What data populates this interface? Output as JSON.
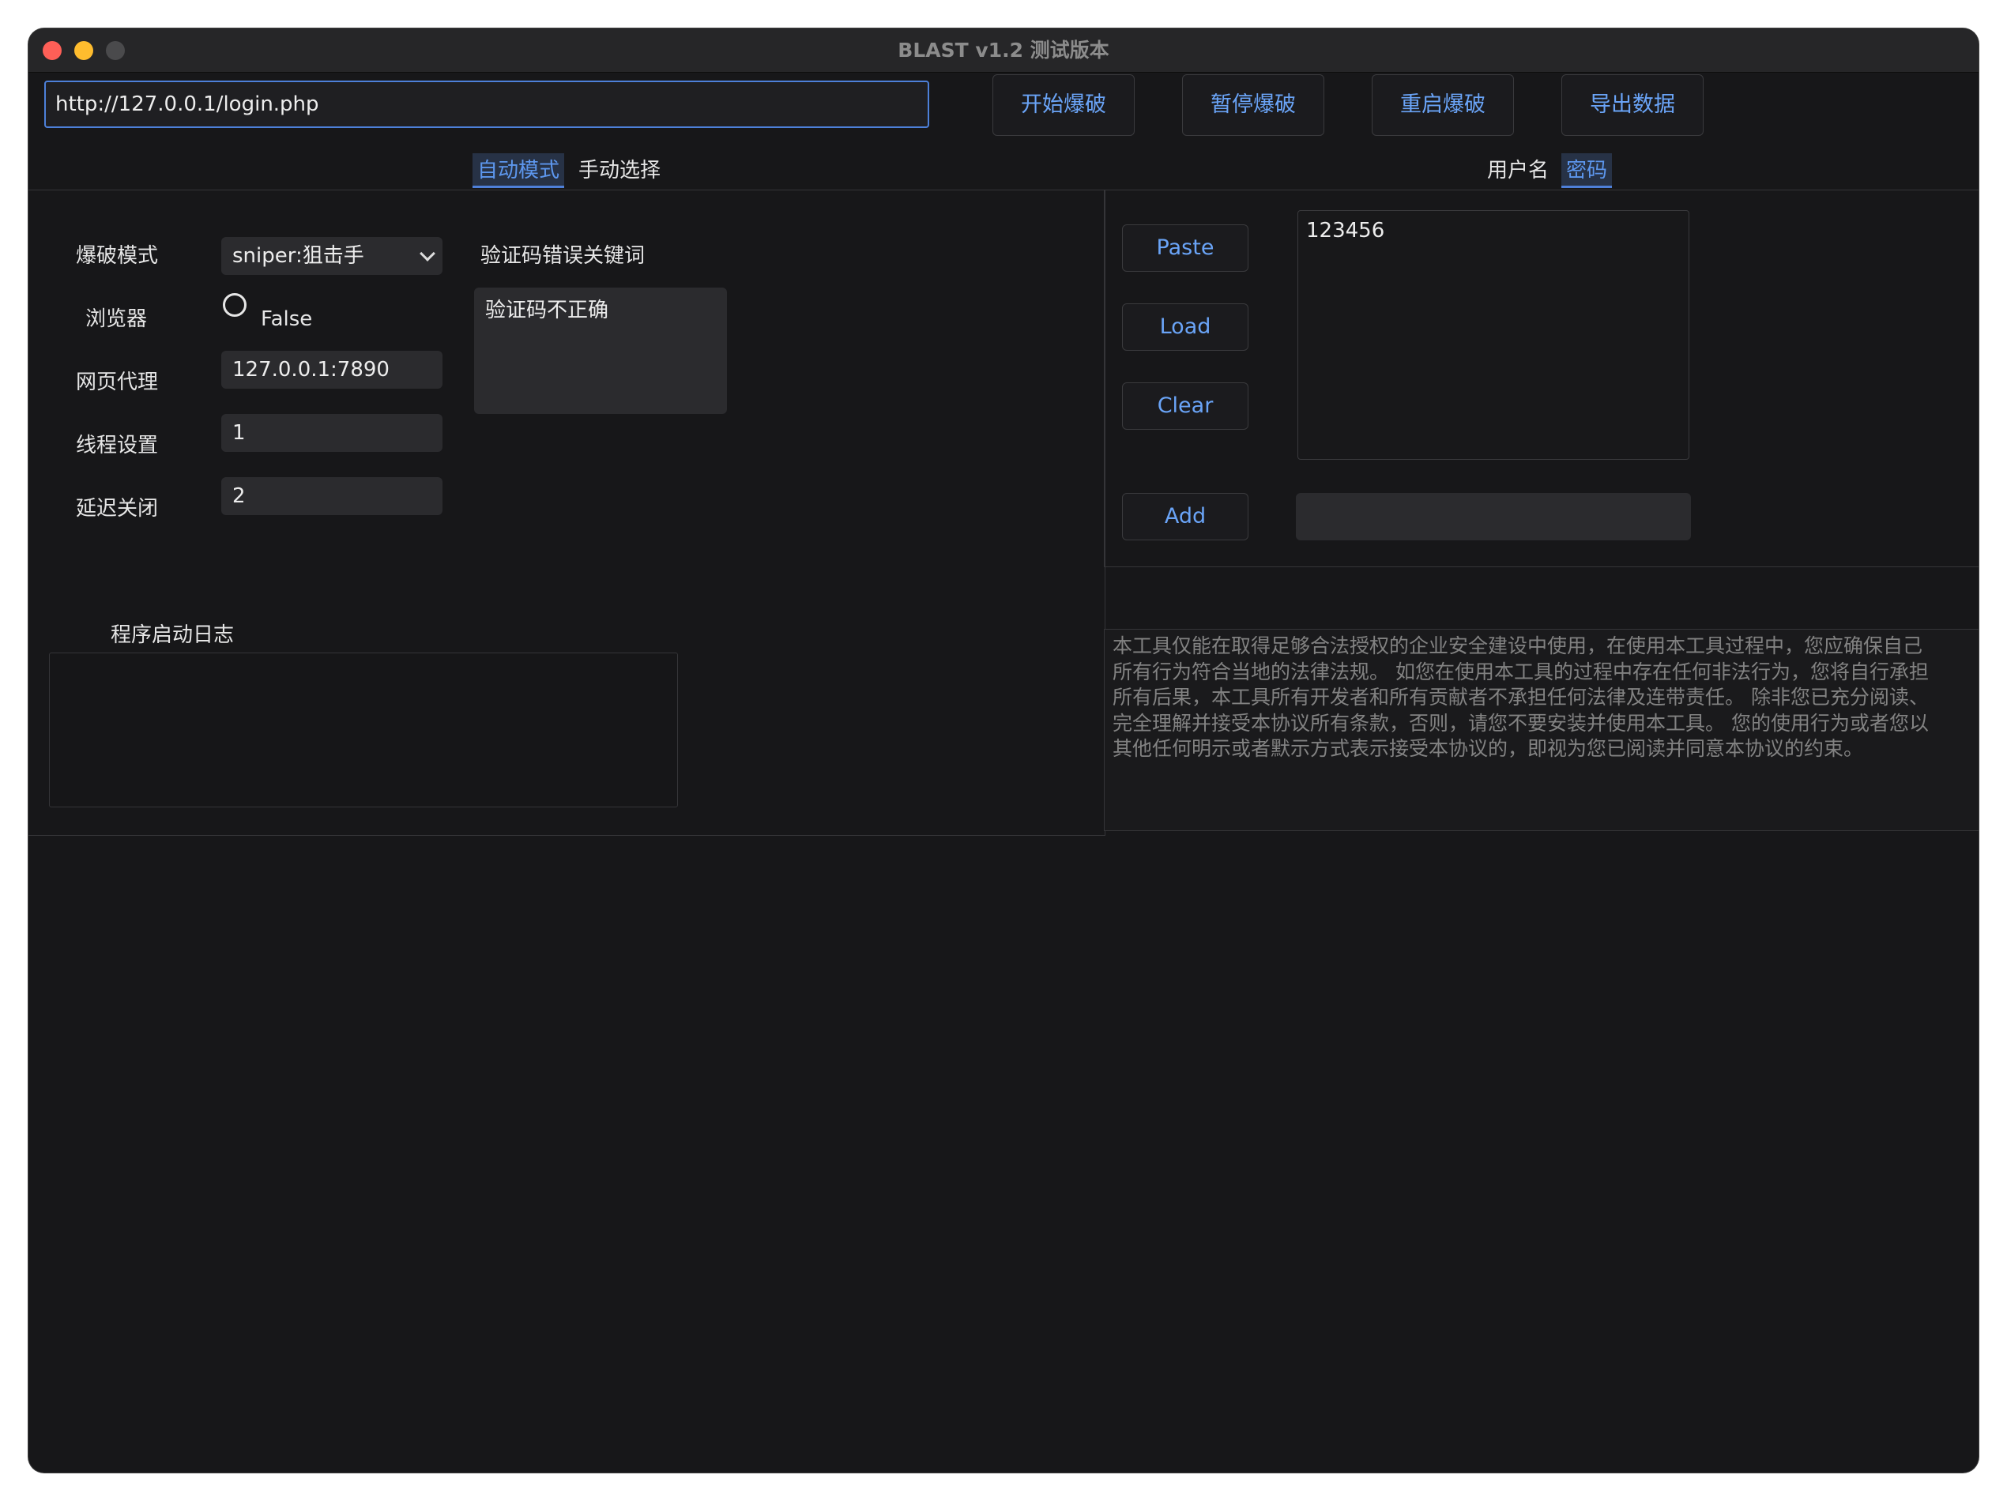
{
  "window": {
    "title": "BLAST v1.2 测试版本"
  },
  "toolbar": {
    "url_value": "http://127.0.0.1/login.php",
    "start_label": "开始爆破",
    "pause_label": "暂停爆破",
    "restart_label": "重启爆破",
    "export_label": "导出数据"
  },
  "mode_tabs": [
    {
      "label": "自动模式",
      "active": true
    },
    {
      "label": "手动选择",
      "active": false
    }
  ],
  "dict_tabs": [
    {
      "label": "用户名",
      "active": false
    },
    {
      "label": "密码",
      "active": true
    }
  ],
  "settings": {
    "mode_label": "爆破模式",
    "mode_value": "sniper:狙击手",
    "browser_label": "浏览器",
    "browser_value": "False",
    "proxy_label": "网页代理",
    "proxy_value": "127.0.0.1:7890",
    "threads_label": "线程设置",
    "threads_value": "1",
    "delay_label": "延迟关闭",
    "delay_value": "2"
  },
  "captcha": {
    "label": "验证码错误关键词",
    "value": "验证码不正确"
  },
  "log": {
    "label": "程序启动日志",
    "content": ""
  },
  "dictionary": {
    "paste_label": "Paste",
    "load_label": "Load",
    "clear_label": "Clear",
    "add_label": "Add",
    "items": [
      "123456"
    ],
    "add_value": ""
  },
  "disclaimer": "本工具仅能在取得足够合法授权的企业安全建设中使用，在使用本工具过程中，您应确保自己\n所有行为符合当地的法律法规。 如您在使用本工具的过程中存在任何非法行为，您将自行承担\n所有后果，本工具所有开发者和所有贡献者不承担任何法律及连带责任。 除非您已充分阅读、\n完全理解并接受本协议所有条款，否则，请您不要安装并使用本工具。 您的使用行为或者您以\n其他任何明示或者默示方式表示接受本协议的，即视为您已阅读并同意本协议的约束。",
  "colors": {
    "accent": "#6aa4f7",
    "background": "#171719",
    "field": "#2b2b2e"
  }
}
